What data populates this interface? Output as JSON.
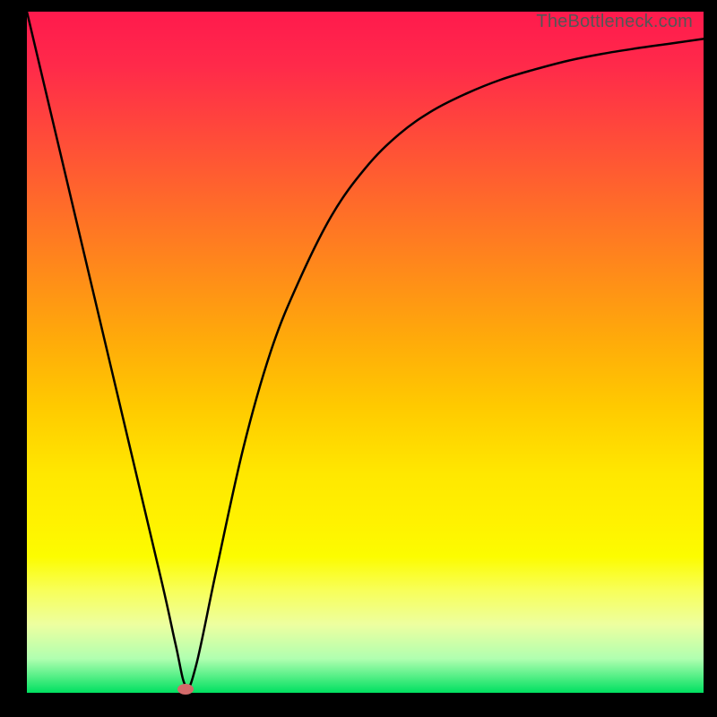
{
  "watermark": "TheBottleneck.com",
  "chart_data": {
    "type": "line",
    "title": "",
    "xlabel": "",
    "ylabel": "",
    "xlim": [
      0,
      100
    ],
    "ylim": [
      0,
      100
    ],
    "series": [
      {
        "name": "bottleneck-curve",
        "x": [
          0,
          5,
          10,
          15,
          20,
          22,
          23.5,
          25,
          28,
          32,
          36,
          40,
          45,
          50,
          55,
          60,
          65,
          70,
          75,
          80,
          85,
          90,
          95,
          100
        ],
        "y": [
          100,
          79,
          58,
          37,
          16,
          7,
          1,
          4,
          18,
          36,
          50,
          60,
          70,
          77,
          82,
          85.5,
          88,
          90,
          91.5,
          92.8,
          93.8,
          94.6,
          95.3,
          96
        ]
      }
    ],
    "marker": {
      "x": 23.5,
      "y": 0.5
    },
    "background_gradient": {
      "top": "#ff1a4d",
      "mid": "#ffca00",
      "bottom": "#00e060"
    }
  }
}
